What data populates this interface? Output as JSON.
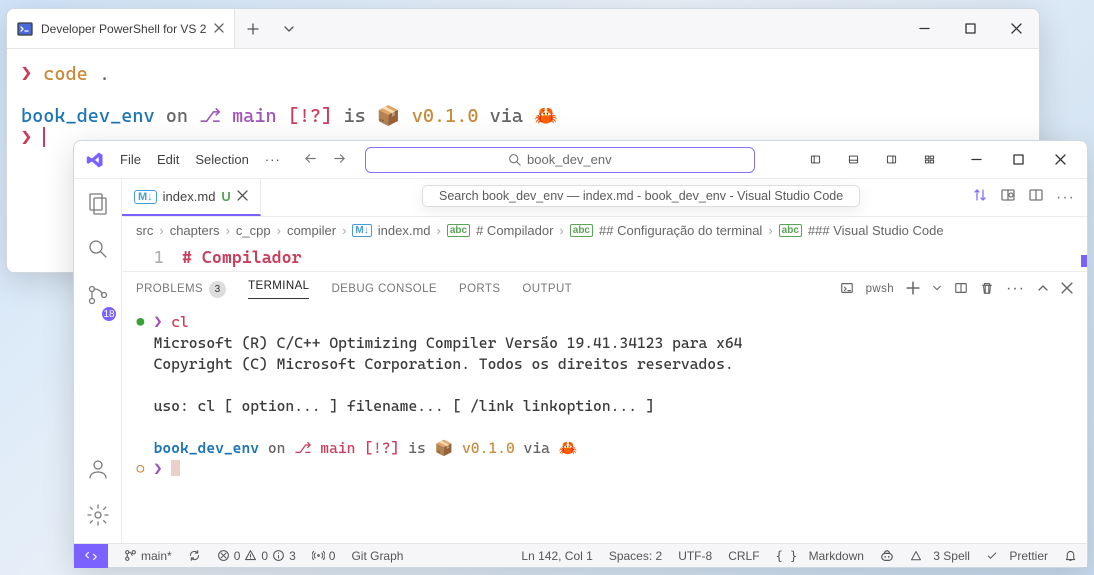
{
  "terminal": {
    "tab_title": "Developer PowerShell for VS 2",
    "prompt1_symbol": "❯",
    "prompt1_cmd": "code",
    "prompt1_arg": ".",
    "line2_dir": "book_dev_env",
    "line2_on": " on ",
    "line2_branch": "main",
    "line2_flags": "[!?]",
    "line2_is": " is ",
    "line2_pkg_icon": "📦",
    "line2_version": "v0.1.0",
    "line2_via": " via ",
    "line2_rust_icon": "🦀",
    "prompt2_symbol": "❯"
  },
  "vscode": {
    "menu": {
      "file": "File",
      "edit": "Edit",
      "selection": "Selection"
    },
    "search_text": "book_dev_env",
    "tooltip": "Search book_dev_env — index.md - book_dev_env - Visual Studio Code",
    "scm_badge": "18",
    "tab": {
      "name": "index.md",
      "mod": "U"
    },
    "breadcrumbs": {
      "p1": "src",
      "p2": "chapters",
      "p3": "c_cpp",
      "p4": "compiler",
      "file": "index.md",
      "h1": "# Compilador",
      "h2": "## Configuração do terminal",
      "h3": "### Visual Studio Code"
    },
    "editor": {
      "lineno": "1",
      "text": "# Compilador"
    },
    "panel": {
      "tabs": {
        "problems": "PROBLEMS",
        "problems_count": "3",
        "terminal": "TERMINAL",
        "debug": "DEBUG CONSOLE",
        "ports": "PORTS",
        "output": "OUTPUT"
      },
      "shell_label": "pwsh",
      "out": {
        "cmd": "cl",
        "l1": "Microsoft (R) C/C++ Optimizing Compiler Versão 19.41.34123 para x64",
        "l2": "Copyright (C) Microsoft Corporation. Todos os direitos reservados.",
        "l3": "uso: cl [ option... ] filename... [ /link linkoption... ]",
        "dir": "book_dev_env",
        "on": " on ",
        "branch": "main",
        "flags": "[!?]",
        "is": " is ",
        "ver": "v0.1.0",
        "via": " via "
      }
    },
    "status": {
      "branch": "main*",
      "errors": "0",
      "warnings": "0",
      "info": "3",
      "ports": "0",
      "gitgraph": "Git Graph",
      "pos": "Ln 142, Col 1",
      "spaces": "Spaces: 2",
      "enc": "UTF-8",
      "eol": "CRLF",
      "lang": "Markdown",
      "spell": "3 Spell",
      "prettier": "Prettier"
    }
  }
}
